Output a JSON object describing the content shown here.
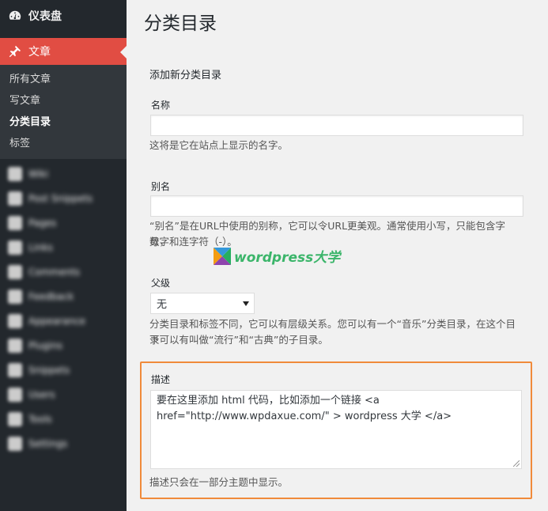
{
  "sidebar": {
    "dashboard_label": "仪表盘",
    "posts_label": "文章",
    "submenu": [
      "所有文章",
      "写文章",
      "分类目录",
      "标签"
    ],
    "blurred": [
      "Wiki",
      "Post Snippets",
      "Pages",
      "Links",
      "Comments",
      "Feedback",
      "Appearance",
      "Plugins",
      "Snippets",
      "Users",
      "Tools",
      "Settings"
    ]
  },
  "page": {
    "title": "分类目录",
    "section_title": "添加新分类目录",
    "name_label": "名称",
    "name_value": "",
    "name_desc": "这将是它在站点上显示的名字。",
    "slug_label": "别名",
    "slug_value": "",
    "slug_desc_1": "“别名”是在URL中使用的别称，它可以令URL更美观。通常使用小写，只能包含字母，",
    "slug_desc_2": "数字和连字符（-）。",
    "parent_label": "父级",
    "parent_value": "无",
    "parent_desc_1": "分类目录和标签不同，它可以有层级关系。您可以有一个“音乐”分类目录，在这个目录",
    "parent_desc_2": "下可以有叫做“流行”和“古典”的子目录。",
    "desc_label": "描述",
    "desc_value_1": "要在这里添加 html 代码，比如添加一个链接 <a",
    "desc_value_2": "href=\"http://www.wpdaxue.com/\" > wordpress 大学 </a>",
    "desc_help": "描述只会在一部分主题中显示。"
  },
  "watermark": {
    "text": "wordpress大学"
  },
  "colors": {
    "sidebar_bg": "#23282d",
    "active_menu": "#e14d43",
    "highlight_border": "#f08a3a",
    "watermark": "#3bb56a"
  }
}
